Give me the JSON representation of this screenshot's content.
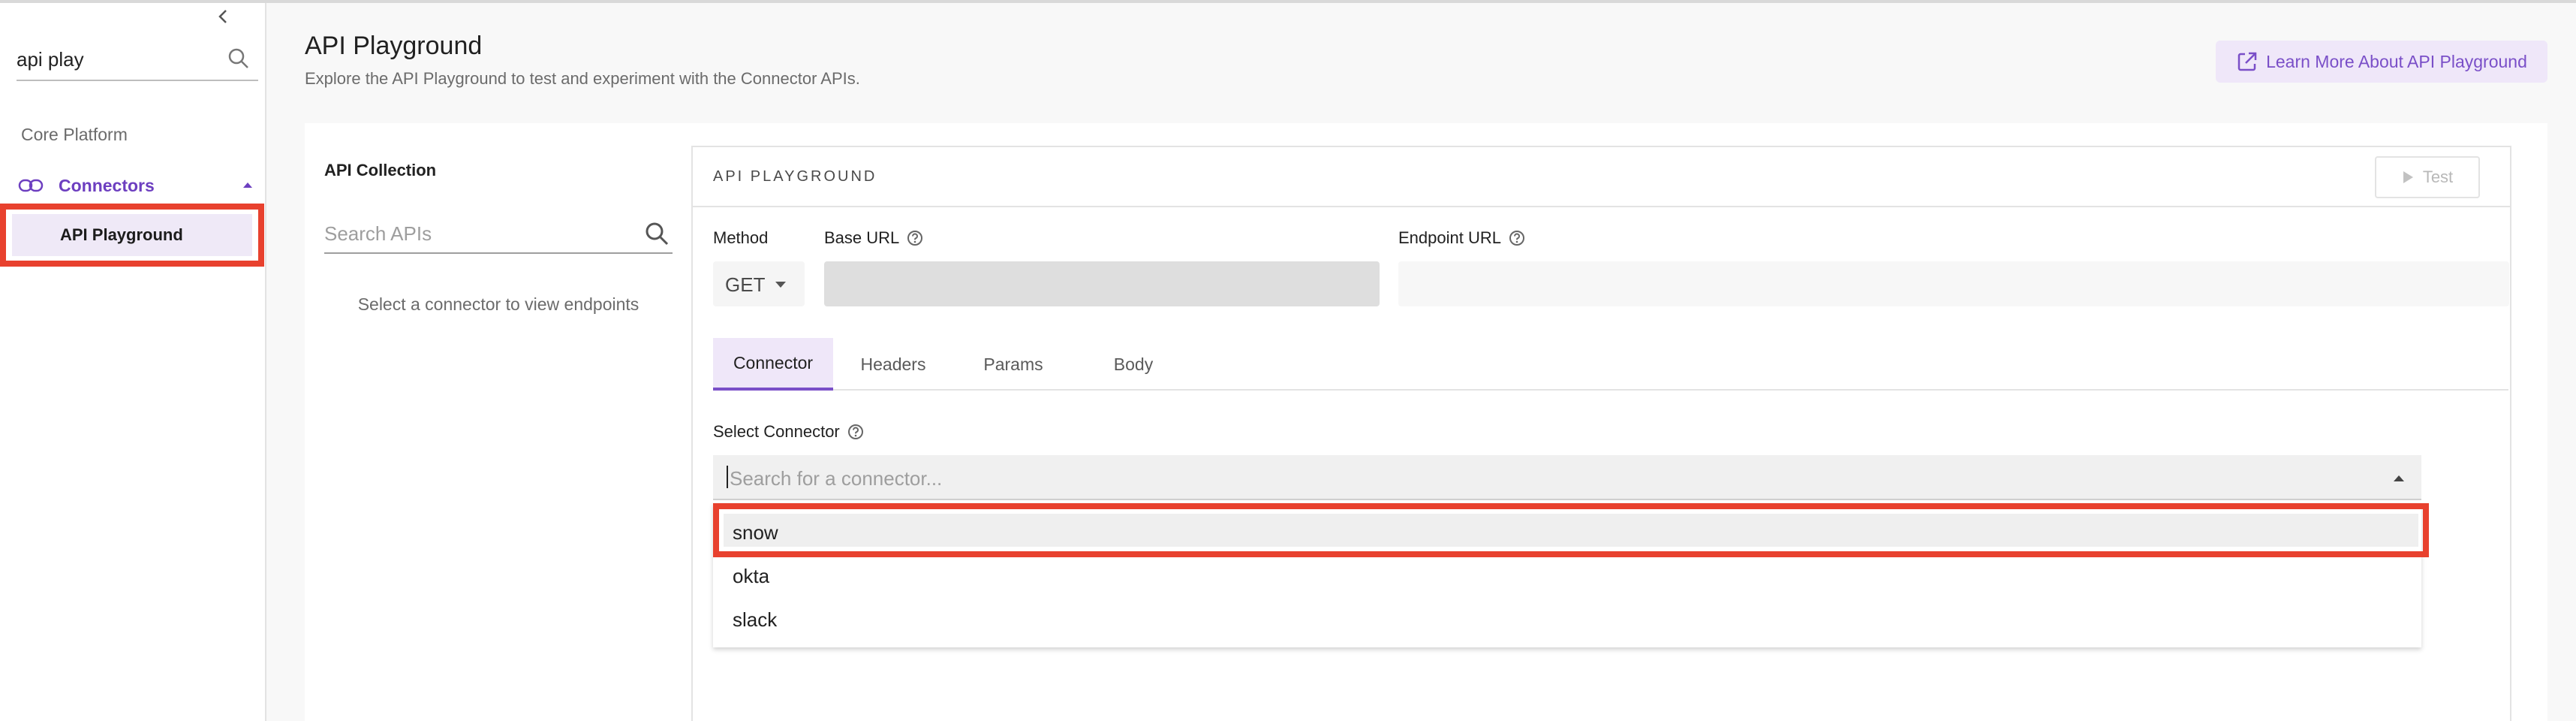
{
  "sidebar": {
    "search_value": "api play",
    "items": [
      {
        "label": "Core Platform"
      },
      {
        "label": "Connectors"
      },
      {
        "label": "API Playground"
      }
    ]
  },
  "header": {
    "title": "API Playground",
    "subtitle": "Explore the API Playground to test and experiment with the Connector APIs.",
    "learn_more_label": "Learn More About API Playground"
  },
  "collection": {
    "title": "API Collection",
    "search_placeholder": "Search APIs",
    "empty_text": "Select a connector to view endpoints"
  },
  "playground": {
    "title": "API PLAYGROUND",
    "test_label": "Test",
    "method_label": "Method",
    "method_value": "GET",
    "base_url_label": "Base URL",
    "endpoint_url_label": "Endpoint URL",
    "tabs": [
      {
        "label": "Connector"
      },
      {
        "label": "Headers"
      },
      {
        "label": "Params"
      },
      {
        "label": "Body"
      }
    ],
    "active_tab": "Connector",
    "select_connector_label": "Select Connector",
    "connector_placeholder": "Search for a connector...",
    "connector_options": [
      {
        "label": "snow"
      },
      {
        "label": "okta"
      },
      {
        "label": "slack"
      }
    ]
  },
  "colors": {
    "accent": "#7a4fc8",
    "highlight_annotation": "#e8412e",
    "active_bg": "#efe7f9"
  }
}
